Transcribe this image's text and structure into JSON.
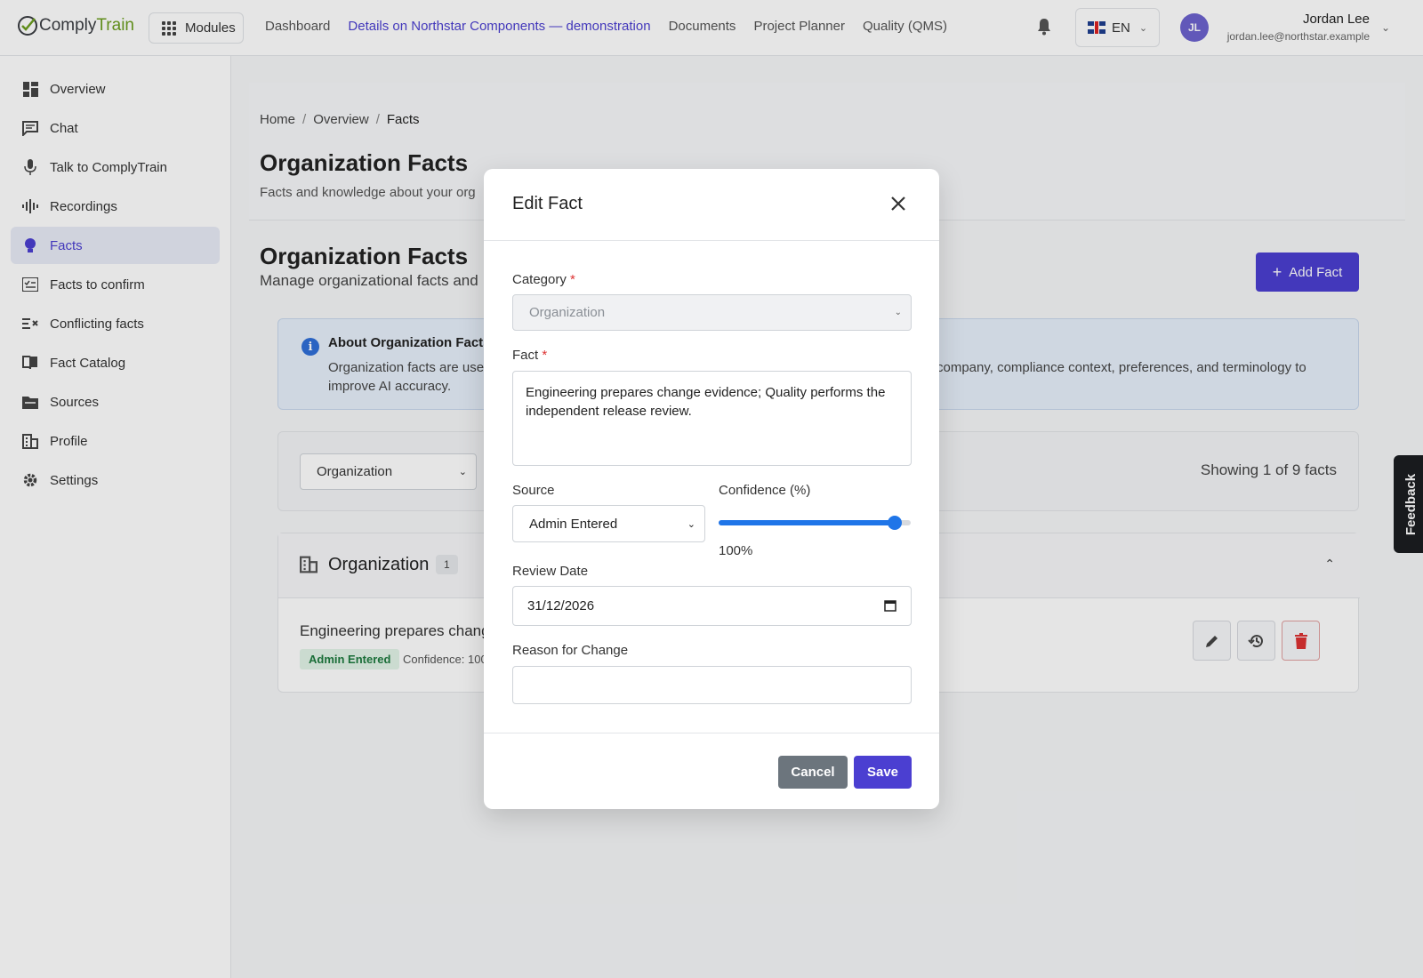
{
  "app": {
    "logo_part1": "Comply",
    "logo_part2": "Train",
    "modules_label": "Modules"
  },
  "topnav": {
    "items": [
      {
        "label": "Dashboard",
        "active": false
      },
      {
        "label": "Details on Northstar Components — demonstration",
        "active": true
      },
      {
        "label": "Documents",
        "active": false
      },
      {
        "label": "Project Planner",
        "active": false
      },
      {
        "label": "Quality (QMS)",
        "active": false
      }
    ]
  },
  "language": {
    "code": "EN"
  },
  "user": {
    "initials": "JL",
    "name": "Jordan Lee",
    "email": "jordan.lee@northstar.example"
  },
  "sidebar": {
    "items": [
      {
        "label": "Overview",
        "icon": "dashboard-icon",
        "active": false
      },
      {
        "label": "Chat",
        "icon": "chat-icon",
        "active": false
      },
      {
        "label": "Talk to ComplyTrain",
        "icon": "microphone-icon",
        "active": false
      },
      {
        "label": "Recordings",
        "icon": "waveform-icon",
        "active": false
      },
      {
        "label": "Facts",
        "icon": "lightbulb-icon",
        "active": true
      },
      {
        "label": "Facts to confirm",
        "icon": "checklist-icon",
        "active": false
      },
      {
        "label": "Conflicting facts",
        "icon": "conflict-icon",
        "active": false
      },
      {
        "label": "Fact Catalog",
        "icon": "book-icon",
        "active": false
      },
      {
        "label": "Sources",
        "icon": "folder-icon",
        "active": false
      },
      {
        "label": "Profile",
        "icon": "building-icon",
        "active": false
      },
      {
        "label": "Settings",
        "icon": "gear-icon",
        "active": false
      }
    ]
  },
  "breadcrumb": {
    "home": "Home",
    "overview": "Overview",
    "current": "Facts"
  },
  "header": {
    "title": "Organization Facts",
    "subtitle": "Facts and knowledge about your org"
  },
  "section": {
    "title": "Organization Facts",
    "subtitle": "Manage organizational facts and",
    "add_button": "Add Fact"
  },
  "info": {
    "title": "About Organization Facts",
    "text_left": "Organization facts are used",
    "text_right": "company, compliance context, preferences, and terminology to",
    "text_line2": "improve AI accuracy."
  },
  "filter": {
    "selected": "Organization",
    "showing": "Showing 1 of 9 facts"
  },
  "group": {
    "title": "Organization",
    "count": "1",
    "fact_text": "Engineering prepares change",
    "fact_badge": "Admin Entered",
    "fact_confidence": "Confidence: 100"
  },
  "feedback_label": "Feedback",
  "modal": {
    "title": "Edit Fact",
    "category_label": "Category",
    "category_value": "Organization",
    "fact_label": "Fact",
    "fact_value": "Engineering prepares change evidence; Quality performs the independent release review.",
    "source_label": "Source",
    "source_value": "Admin Entered",
    "confidence_label": "Confidence (%)",
    "confidence_value": 100,
    "confidence_display": "100%",
    "review_date_label": "Review Date",
    "review_date_value": "31/12/2026",
    "reason_label": "Reason for Change",
    "reason_value": "",
    "cancel_label": "Cancel",
    "save_label": "Save"
  },
  "colors": {
    "accent": "#4b3fd1",
    "slider": "#1f75e8",
    "danger": "#d33333",
    "badge_bg": "#e3f4e8"
  }
}
